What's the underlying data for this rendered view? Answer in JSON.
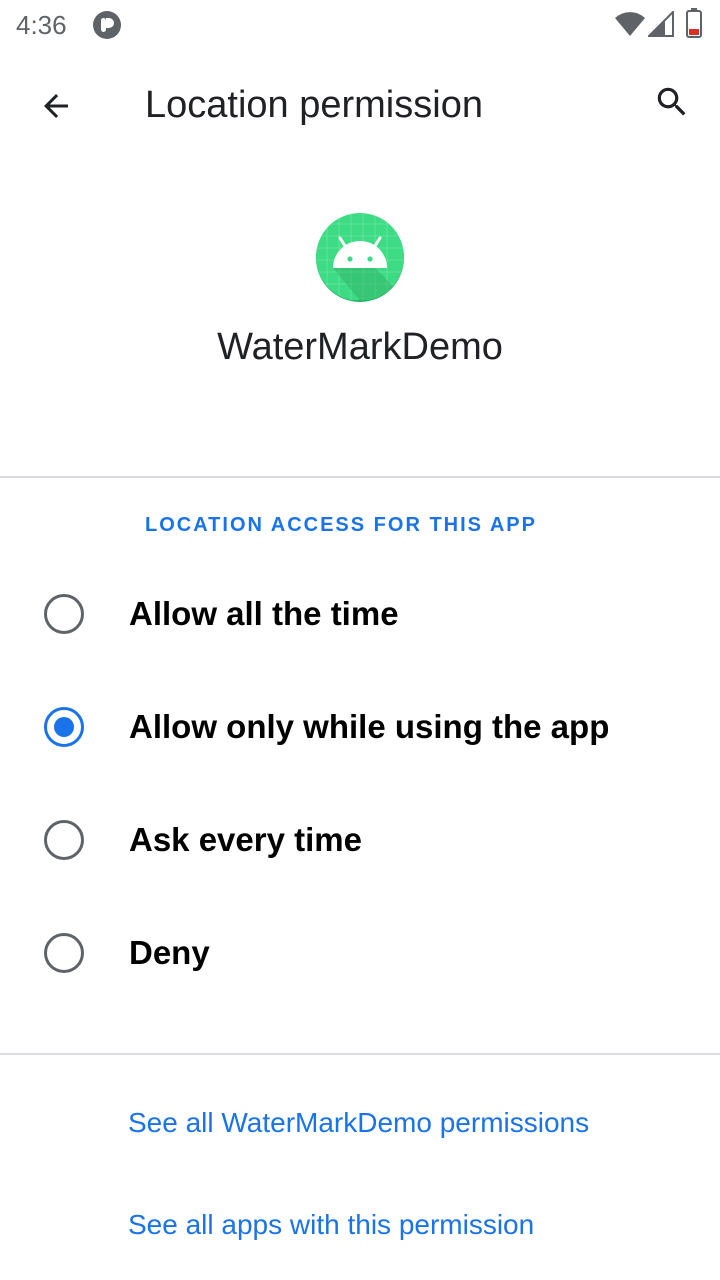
{
  "status_bar": {
    "time": "4:36",
    "icons": [
      "notification-icon",
      "wifi-icon",
      "signal-icon",
      "battery-icon"
    ]
  },
  "toolbar": {
    "title": "Location permission",
    "back_icon": "arrow-back-icon",
    "search_icon": "search-icon"
  },
  "app": {
    "name": "WaterMarkDemo",
    "icon": "android-robot-icon",
    "icon_color": "#3ddc84"
  },
  "section": {
    "header": "LOCATION ACCESS FOR THIS APP"
  },
  "options": [
    {
      "label": "Allow all the time",
      "checked": false
    },
    {
      "label": "Allow only while using the app",
      "checked": true
    },
    {
      "label": "Ask every time",
      "checked": false
    },
    {
      "label": "Deny",
      "checked": false
    }
  ],
  "links": {
    "app_permissions": "See all WaterMarkDemo permissions",
    "all_apps": "See all apps with this permission"
  },
  "colors": {
    "accent": "#1a73e8",
    "divider": "#dadce0"
  }
}
